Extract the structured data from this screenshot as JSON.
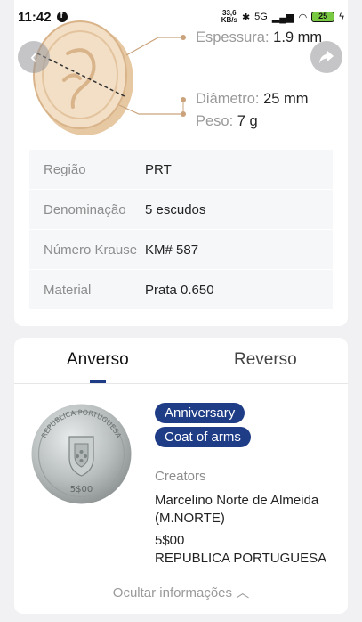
{
  "status_bar": {
    "time": "11:42",
    "speed_value": "33,6",
    "speed_unit": "KB/s",
    "network": "5G",
    "battery": "25"
  },
  "coin_dims": {
    "thickness_label": "Espessura:",
    "thickness_value": "1.9 mm",
    "diameter_label": "Diâmetro:",
    "diameter_value": "25 mm",
    "weight_label": "Peso:",
    "weight_value": "7 g"
  },
  "specs": [
    {
      "key": "Região",
      "value": "PRT"
    },
    {
      "key": "Denominação",
      "value": "5 escudos"
    },
    {
      "key": "Número Krause",
      "value": "KM# 587"
    },
    {
      "key": "Material",
      "value": "Prata 0.650"
    }
  ],
  "tabs": {
    "obverse": "Anverso",
    "reverse": "Reverso"
  },
  "obverse": {
    "tags": [
      "Anniversary",
      "Coat of arms"
    ],
    "creators_label": "Creators",
    "creator": "Marcelino Norte de Almeida (M.NORTE)",
    "legend_line1": "5$00",
    "legend_line2": "REPUBLICA PORTUGUESA",
    "coin_text_top": "REPUBLICA PORTUGUESA",
    "coin_text_value": "5$00"
  },
  "hide_info": "Ocultar informações",
  "colors": {
    "accent": "#1f3d86",
    "coin_sketch": "#e8cfae",
    "muted_text": "#8d8d8d"
  }
}
